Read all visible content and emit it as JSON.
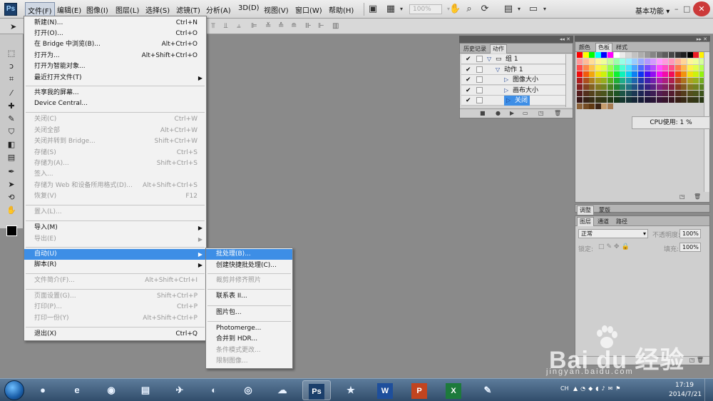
{
  "app": {
    "logo": "Ps",
    "accent": "#3d8ee6"
  },
  "menubar": {
    "items": [
      "文件(F)",
      "编辑(E)",
      "图像(I)",
      "图层(L)",
      "选择(S)",
      "滤镜(T)",
      "分析(A)",
      "3D(D)",
      "视图(V)",
      "窗口(W)",
      "帮助(H)"
    ],
    "zoom": "100%",
    "workspace": "基本功能",
    "workspace_arrow": "▾",
    "min": "–",
    "max": "□",
    "close": "✕"
  },
  "file_menu": {
    "items": [
      {
        "label": "新建(N)...",
        "shortcut": "Ctrl+N",
        "enabled": true
      },
      {
        "label": "打开(O)...",
        "shortcut": "Ctrl+O",
        "enabled": true
      },
      {
        "label": "在 Bridge 中浏览(B)...",
        "shortcut": "Alt+Ctrl+O",
        "enabled": true
      },
      {
        "label": "打开为...",
        "shortcut": "Alt+Shift+Ctrl+O",
        "enabled": true
      },
      {
        "label": "打开为智能对象...",
        "shortcut": "",
        "enabled": true
      },
      {
        "label": "最近打开文件(T)",
        "shortcut": "",
        "enabled": true,
        "submenu": true
      },
      {
        "label": "共享我的屏幕...",
        "shortcut": "",
        "enabled": true
      },
      {
        "label": "Device Central...",
        "shortcut": "",
        "enabled": true
      },
      {
        "label": "关闭(C)",
        "shortcut": "Ctrl+W",
        "enabled": false
      },
      {
        "label": "关闭全部",
        "shortcut": "Alt+Ctrl+W",
        "enabled": false
      },
      {
        "label": "关闭并转到 Bridge...",
        "shortcut": "Shift+Ctrl+W",
        "enabled": false
      },
      {
        "label": "存储(S)",
        "shortcut": "Ctrl+S",
        "enabled": false
      },
      {
        "label": "存储为(A)...",
        "shortcut": "Shift+Ctrl+S",
        "enabled": false
      },
      {
        "label": "签入...",
        "shortcut": "",
        "enabled": false
      },
      {
        "label": "存储为 Web 和设备所用格式(D)...",
        "shortcut": "Alt+Shift+Ctrl+S",
        "enabled": false
      },
      {
        "label": "恢复(V)",
        "shortcut": "F12",
        "enabled": false
      },
      {
        "label": "置入(L)...",
        "shortcut": "",
        "enabled": false
      },
      {
        "label": "导入(M)",
        "shortcut": "",
        "enabled": true,
        "submenu": true
      },
      {
        "label": "导出(E)",
        "shortcut": "",
        "enabled": false,
        "submenu": true
      },
      {
        "label": "自动(U)",
        "shortcut": "",
        "enabled": true,
        "submenu": true,
        "highlighted": true
      },
      {
        "label": "脚本(R)",
        "shortcut": "",
        "enabled": true,
        "submenu": true
      },
      {
        "label": "文件简介(F)...",
        "shortcut": "Alt+Shift+Ctrl+I",
        "enabled": false
      },
      {
        "label": "页面设置(G)...",
        "shortcut": "Shift+Ctrl+P",
        "enabled": false
      },
      {
        "label": "打印(P)...",
        "shortcut": "Ctrl+P",
        "enabled": false
      },
      {
        "label": "打印一份(Y)",
        "shortcut": "Alt+Shift+Ctrl+P",
        "enabled": false
      },
      {
        "label": "退出(X)",
        "shortcut": "Ctrl+Q",
        "enabled": true
      }
    ]
  },
  "auto_submenu": {
    "items": [
      {
        "label": "批处理(B)...",
        "enabled": true,
        "highlighted": true
      },
      {
        "label": "创建快捷批处理(C)...",
        "enabled": true
      },
      {
        "label": "裁剪并修齐照片",
        "enabled": false
      },
      {
        "label": "联系表 II...",
        "enabled": true
      },
      {
        "label": "图片包...",
        "enabled": true
      },
      {
        "label": "Photomerge...",
        "enabled": true
      },
      {
        "label": "合并到 HDR...",
        "enabled": true
      },
      {
        "label": "条件模式更改...",
        "enabled": false
      },
      {
        "label": "限制图像...",
        "enabled": false
      }
    ]
  },
  "history_panel": {
    "tabs": [
      "历史记录",
      "动作"
    ],
    "active_tab": 1,
    "rows": [
      {
        "label": "组 1",
        "indent": 0,
        "kind": "folder"
      },
      {
        "label": "动作 1",
        "indent": 1,
        "kind": "action"
      },
      {
        "label": "图像大小",
        "indent": 2,
        "kind": "step"
      },
      {
        "label": "画布大小",
        "indent": 2,
        "kind": "step"
      },
      {
        "label": "关闭",
        "indent": 2,
        "kind": "step",
        "selected": true
      }
    ],
    "check": "✔"
  },
  "swatch_panel": {
    "tabs": [
      "颜色",
      "色板",
      "样式"
    ],
    "active_tab": 1
  },
  "cpu": "CPU使用: 1 %",
  "adjust_strip": {
    "tabs": [
      "调整",
      "蒙版"
    ]
  },
  "layers_panel": {
    "tabs": [
      "图层",
      "通道",
      "路径"
    ],
    "blend_mode": "正常",
    "opacity_label": "不透明度:",
    "opacity": "100%",
    "lock_label": "锁定:",
    "fill_label": "填充:",
    "fill": "100%"
  },
  "taskbar": {
    "ime": "CH",
    "time": "17:19",
    "date": "2014/7/21",
    "apps": [
      {
        "name": "app-colorful",
        "glyph": "●"
      },
      {
        "name": "internet-explorer",
        "glyph": "e"
      },
      {
        "name": "browser-360",
        "glyph": "◉"
      },
      {
        "name": "file-explorer",
        "glyph": "▤"
      },
      {
        "name": "bird-app",
        "glyph": "✈"
      },
      {
        "name": "app-blue-sphere",
        "glyph": "◐"
      },
      {
        "name": "app-qq-player",
        "glyph": "◎"
      },
      {
        "name": "cloud-app",
        "glyph": "☁"
      },
      {
        "name": "photoshop",
        "glyph": "Ps"
      },
      {
        "name": "app-star",
        "glyph": "★"
      },
      {
        "name": "word",
        "glyph": "W"
      },
      {
        "name": "powerpoint",
        "glyph": "P"
      },
      {
        "name": "excel",
        "glyph": "X"
      },
      {
        "name": "paint",
        "glyph": "✎"
      }
    ]
  },
  "watermark": {
    "main": "Bai du 经验",
    "sub": "jingyan.baidu.com"
  }
}
